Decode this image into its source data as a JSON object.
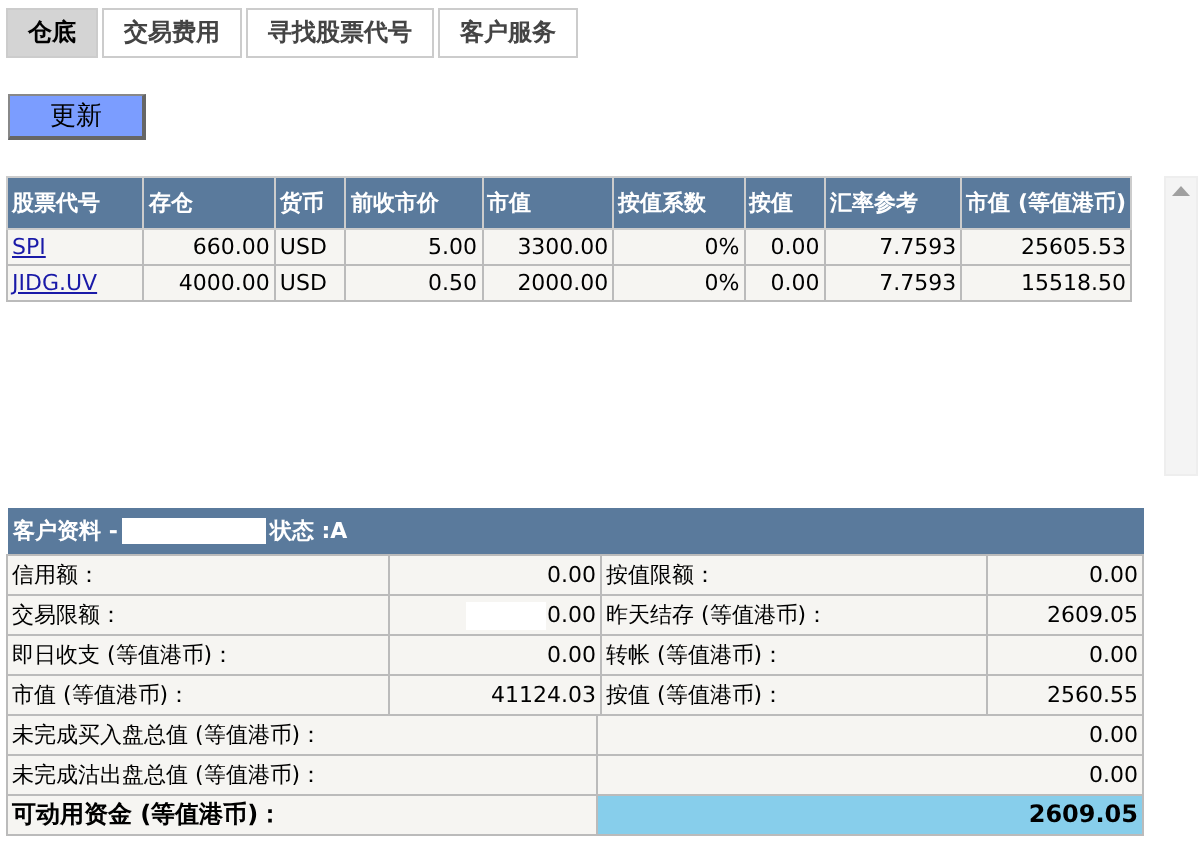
{
  "tabs": [
    {
      "label": "仓底",
      "selected": true
    },
    {
      "label": "交易费用",
      "selected": false
    },
    {
      "label": "寻找股票代号",
      "selected": false
    },
    {
      "label": "客户服务",
      "selected": false
    }
  ],
  "refresh_button": "更新",
  "holdings": {
    "columns": [
      "股票代号",
      "存仓",
      "货币",
      "前收市价",
      "市值",
      "按值系数",
      "按值",
      "汇率参考",
      "市值 (等值港币)"
    ],
    "rows": [
      {
        "cells": [
          "SPI",
          "660.00",
          "USD",
          "5.00",
          "3300.00",
          "0%",
          "0.00",
          "7.7593",
          "25605.53"
        ]
      },
      {
        "cells": [
          "JIDG.UV",
          "4000.00",
          "USD",
          "0.50",
          "2000.00",
          "0%",
          "0.00",
          "7.7593",
          "15518.50"
        ]
      }
    ]
  },
  "account": {
    "title": "客户资料 -",
    "status": "状态 :A",
    "rows": [
      {
        "kind": "pair",
        "cells": [
          "信用额：",
          "0.00",
          "按值限额：",
          "0.00"
        ]
      },
      {
        "kind": "pair",
        "cells": [
          "交易限额：",
          "0.00",
          "昨天结存 (等值港币)：",
          "2609.05"
        ]
      },
      {
        "kind": "pair",
        "cells": [
          "即日收支 (等值港币)：",
          "0.00",
          "转帐 (等值港币)：",
          "0.00"
        ]
      },
      {
        "kind": "pair",
        "cells": [
          "市值 (等值港币)：",
          "41124.03",
          "按值 (等值港币)：",
          "2560.55"
        ]
      }
    ],
    "totals": [
      {
        "kind": "wide",
        "cells": [
          "未完成买入盘总值 (等值港币)：",
          "0.00"
        ]
      },
      {
        "kind": "wide",
        "cells": [
          "未完成沽出盘总值 (等值港币)：",
          "0.00"
        ]
      },
      {
        "kind": "total",
        "cells": [
          "可动用资金 (等值港币)：",
          "2609.05"
        ]
      }
    ]
  }
}
